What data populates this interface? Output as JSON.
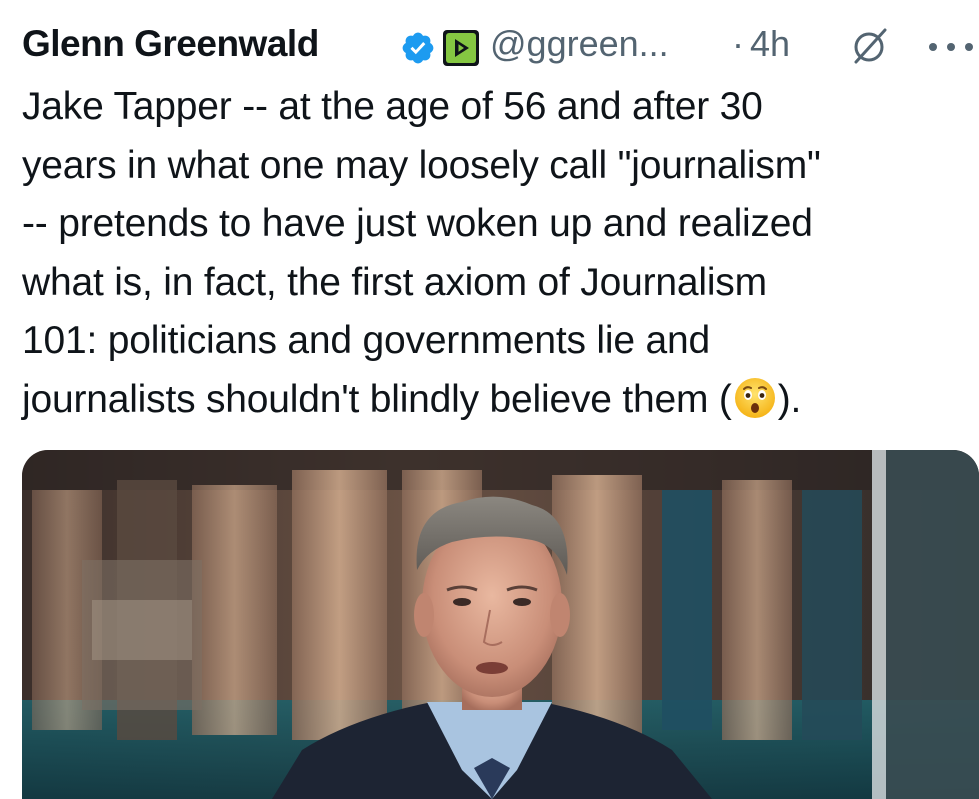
{
  "tweet": {
    "author_name": "Glenn Greenwald",
    "handle": "@ggreen...",
    "separator": "·",
    "time": "4h",
    "text_lines": [
      "Jake Tapper -- at the age of 56 and after 30",
      "years in what one may loosely call \"journalism\"",
      "-- pretends to have just woken up and realized",
      "what is, in fact, the first axiom of Journalism",
      "101: politicians and governments lie and"
    ],
    "last_line_before_emoji": "journalists shouldn't blindly believe them (",
    "last_line_after_emoji": ").",
    "emoji": "hushed-face-emoji"
  },
  "icons": {
    "verified": "verified-badge-icon",
    "rumble": "rumble-logo-icon",
    "grok": "grok-icon",
    "more": "more-options-icon"
  },
  "colors": {
    "verified_blue": "#1d9bf0",
    "rumble_green": "#85c742",
    "secondary_text": "#536471",
    "primary_text": "#0f1419"
  },
  "media": {
    "type": "video-still",
    "subject": "news-anchor-photo"
  }
}
